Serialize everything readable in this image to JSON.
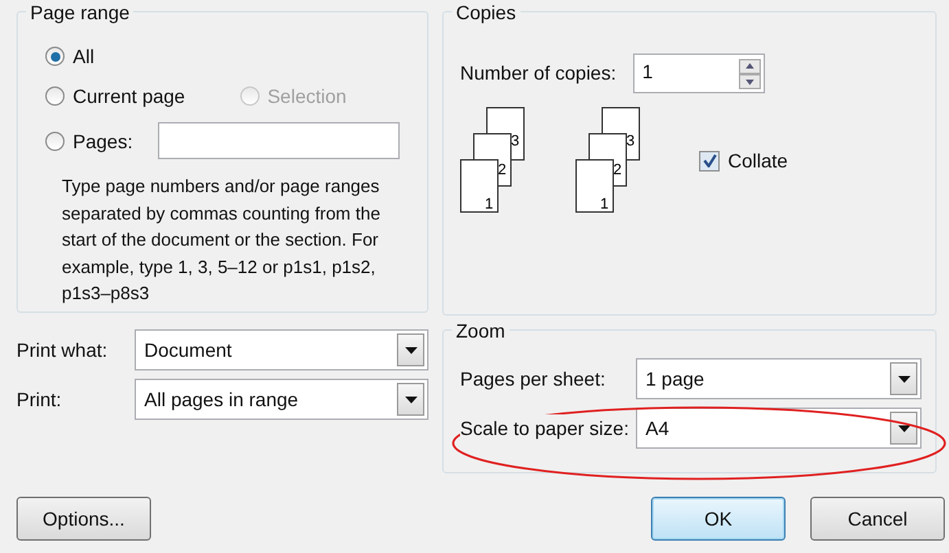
{
  "page_range": {
    "title": "Page range",
    "options": [
      {
        "label": "All",
        "selected": true,
        "disabled": false
      },
      {
        "label": "Current page",
        "selected": false,
        "disabled": false
      },
      {
        "label": "Selection",
        "selected": false,
        "disabled": true
      },
      {
        "label": "Pages:",
        "selected": false,
        "disabled": false
      }
    ],
    "hint": "Type page numbers and/or page ranges separated by commas counting from the start of the document or the section. For example, type 1, 3, 5–12 or p1s1, p1s2, p1s3–p8s3"
  },
  "copies": {
    "title": "Copies",
    "label": "Number of copies:",
    "value": "1",
    "stacks": [
      {
        "pages": [
          "3",
          "2",
          "1"
        ]
      },
      {
        "pages": [
          "3",
          "2",
          "1"
        ]
      }
    ],
    "collate": {
      "label": "Collate",
      "checked": true
    }
  },
  "print_what": {
    "label": "Print what:",
    "value": "Document"
  },
  "print": {
    "label": "Print:",
    "value": "All pages in range"
  },
  "zoom": {
    "title": "Zoom",
    "rows": [
      {
        "label": "Pages per sheet:",
        "value": "1 page"
      },
      {
        "label": "Scale to paper size:",
        "value": "A4"
      }
    ]
  },
  "buttons": [
    {
      "label": "Options...",
      "kind": "plain"
    },
    {
      "label": "OK",
      "kind": "default"
    },
    {
      "label": "Cancel",
      "kind": "plain"
    }
  ]
}
